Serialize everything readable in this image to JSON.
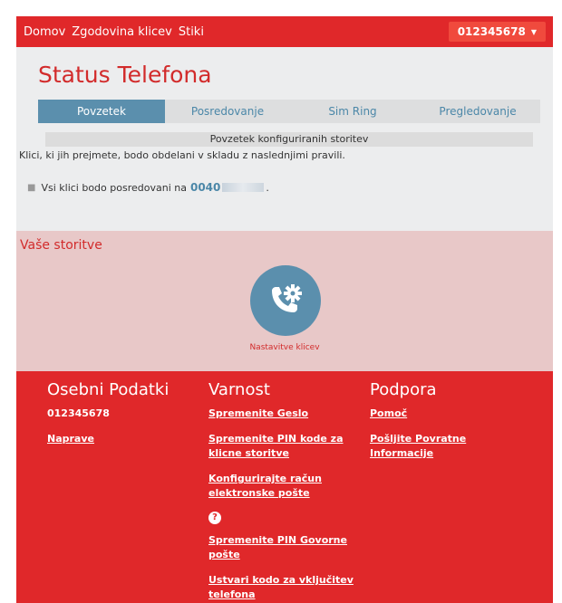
{
  "nav": {
    "links": [
      "Domov",
      "Zgodovina klicev",
      "Stiki"
    ],
    "account_number": "012345678"
  },
  "status": {
    "title": "Status Telefona",
    "tabs": [
      "Povzetek",
      "Posredovanje",
      "Sim Ring",
      "Pregledovanje"
    ],
    "active_tab": "Povzetek",
    "summary_header": "Povzetek konfiguriranih storitev",
    "rules_text": "Klici, ki jih prejmete, bodo obdelani v skladu z naslednjimi pravili.",
    "forward_text": "Vsi klici bodo posredovani na",
    "forward_number": "0040",
    "forward_suffix": "."
  },
  "services": {
    "title": "Vaše storitve",
    "call_settings_label": "Nastavitve klicev"
  },
  "footer": {
    "personal": {
      "heading": "Osebni Podatki",
      "number": "012345678",
      "devices_link": "Naprave"
    },
    "security": {
      "heading": "Varnost",
      "links": [
        "Spremenite Geslo",
        "Spremenite PIN kode za klicne storitve",
        "Konfigurirajte račun elektronske pošte",
        "Spremenite PIN Govorne pošte",
        "Ustvari kodo za vključitev telefona"
      ]
    },
    "support": {
      "heading": "Podpora",
      "links": [
        "Pomoč",
        "Pošljite Povratne Informacije"
      ]
    }
  },
  "colors": {
    "brand_red": "#e0282a",
    "accent_blue": "#5b8fad",
    "services_bg": "#e8c8c8"
  }
}
